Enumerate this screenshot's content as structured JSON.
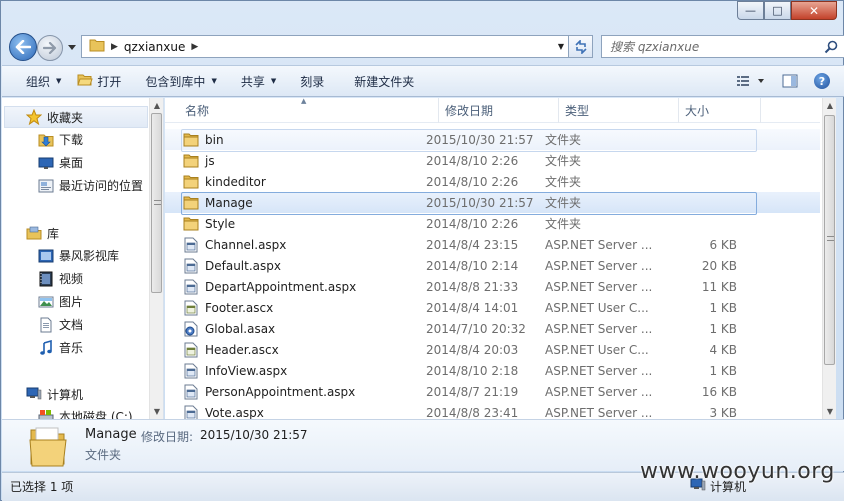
{
  "window": {
    "controls": {
      "minimize": "—",
      "maximize": "□",
      "close": "✕"
    }
  },
  "address_bar": {
    "crumbs": [
      "qzxianxue"
    ]
  },
  "search": {
    "placeholder": "搜索 qzxianxue"
  },
  "toolbar": {
    "organize": "组织",
    "open": "打开",
    "include_in_library": "包含到库中",
    "share": "共享",
    "burn": "刻录",
    "new_folder": "新建文件夹"
  },
  "navpane": {
    "favorites": {
      "label": "收藏夹",
      "items": [
        {
          "label": "下载",
          "icon": "download-folder-icon"
        },
        {
          "label": "桌面",
          "icon": "desktop-icon"
        },
        {
          "label": "最近访问的位置",
          "icon": "recent-places-icon"
        }
      ]
    },
    "libraries": {
      "label": "库",
      "items": [
        {
          "label": "暴风影视库",
          "icon": "video-library-icon"
        },
        {
          "label": "视频",
          "icon": "videos-icon"
        },
        {
          "label": "图片",
          "icon": "pictures-icon"
        },
        {
          "label": "文档",
          "icon": "documents-icon"
        },
        {
          "label": "音乐",
          "icon": "music-icon"
        }
      ]
    },
    "computer": {
      "label": "计算机",
      "items": [
        {
          "label": "本地磁盘 (C:)",
          "icon": "drive-icon"
        }
      ]
    }
  },
  "columns": {
    "name": "名称",
    "date": "修改日期",
    "type": "类型",
    "size": "大小"
  },
  "files": [
    {
      "name": "bin",
      "date": "2015/10/30 21:57",
      "type": "文件夹",
      "size": "",
      "kind": "folder",
      "state": "hover"
    },
    {
      "name": "js",
      "date": "2014/8/10 2:26",
      "type": "文件夹",
      "size": "",
      "kind": "folder",
      "state": ""
    },
    {
      "name": "kindeditor",
      "date": "2014/8/10 2:26",
      "type": "文件夹",
      "size": "",
      "kind": "folder",
      "state": ""
    },
    {
      "name": "Manage",
      "date": "2015/10/30 21:57",
      "type": "文件夹",
      "size": "",
      "kind": "folder",
      "state": "selected"
    },
    {
      "name": "Style",
      "date": "2014/8/10 2:26",
      "type": "文件夹",
      "size": "",
      "kind": "folder",
      "state": ""
    },
    {
      "name": "Channel.aspx",
      "date": "2014/8/4 23:15",
      "type": "ASP.NET Server ...",
      "size": "6 KB",
      "kind": "aspx",
      "state": ""
    },
    {
      "name": "Default.aspx",
      "date": "2014/8/10 2:14",
      "type": "ASP.NET Server ...",
      "size": "20 KB",
      "kind": "aspx",
      "state": ""
    },
    {
      "name": "DepartAppointment.aspx",
      "date": "2014/8/8 21:33",
      "type": "ASP.NET Server ...",
      "size": "11 KB",
      "kind": "aspx",
      "state": ""
    },
    {
      "name": "Footer.ascx",
      "date": "2014/8/4 14:01",
      "type": "ASP.NET User C...",
      "size": "1 KB",
      "kind": "ascx",
      "state": ""
    },
    {
      "name": "Global.asax",
      "date": "2014/7/10 20:32",
      "type": "ASP.NET Server ...",
      "size": "1 KB",
      "kind": "asax",
      "state": ""
    },
    {
      "name": "Header.ascx",
      "date": "2014/8/4 20:03",
      "type": "ASP.NET User C...",
      "size": "4 KB",
      "kind": "ascx",
      "state": ""
    },
    {
      "name": "InfoView.aspx",
      "date": "2014/8/10 2:18",
      "type": "ASP.NET Server ...",
      "size": "1 KB",
      "kind": "aspx",
      "state": ""
    },
    {
      "name": "PersonAppointment.aspx",
      "date": "2014/8/7 21:19",
      "type": "ASP.NET Server ...",
      "size": "16 KB",
      "kind": "aspx",
      "state": ""
    },
    {
      "name": "Vote.aspx",
      "date": "2014/8/8 23:41",
      "type": "ASP.NET Server ...",
      "size": "3 KB",
      "kind": "aspx",
      "state": ""
    }
  ],
  "details": {
    "name": "Manage",
    "date_label": "修改日期:",
    "date": "2015/10/30 21:57",
    "type": "文件夹"
  },
  "statusbar": {
    "selection": "已选择 1 项",
    "location": "计算机"
  },
  "watermark": "www.wooyun.org",
  "colors": {
    "selection_border": "#84acdd",
    "accent": "#2c68b8"
  }
}
